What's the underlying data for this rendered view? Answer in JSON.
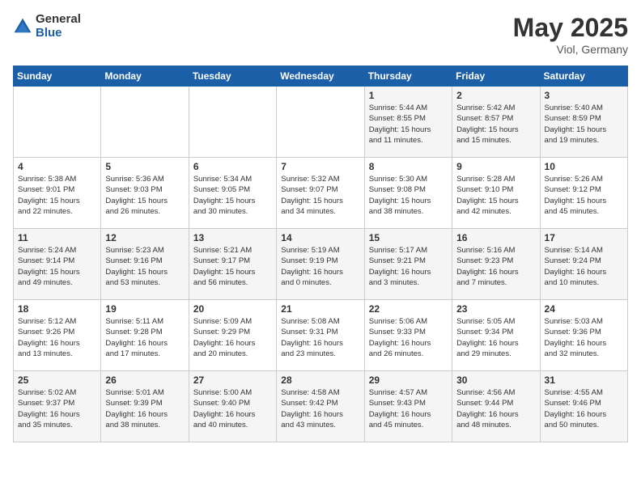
{
  "header": {
    "logo_general": "General",
    "logo_blue": "Blue",
    "month": "May 2025",
    "location": "Viol, Germany"
  },
  "weekdays": [
    "Sunday",
    "Monday",
    "Tuesday",
    "Wednesday",
    "Thursday",
    "Friday",
    "Saturday"
  ],
  "weeks": [
    [
      {
        "day": "",
        "content": ""
      },
      {
        "day": "",
        "content": ""
      },
      {
        "day": "",
        "content": ""
      },
      {
        "day": "",
        "content": ""
      },
      {
        "day": "1",
        "content": "Sunrise: 5:44 AM\nSunset: 8:55 PM\nDaylight: 15 hours\nand 11 minutes."
      },
      {
        "day": "2",
        "content": "Sunrise: 5:42 AM\nSunset: 8:57 PM\nDaylight: 15 hours\nand 15 minutes."
      },
      {
        "day": "3",
        "content": "Sunrise: 5:40 AM\nSunset: 8:59 PM\nDaylight: 15 hours\nand 19 minutes."
      }
    ],
    [
      {
        "day": "4",
        "content": "Sunrise: 5:38 AM\nSunset: 9:01 PM\nDaylight: 15 hours\nand 22 minutes."
      },
      {
        "day": "5",
        "content": "Sunrise: 5:36 AM\nSunset: 9:03 PM\nDaylight: 15 hours\nand 26 minutes."
      },
      {
        "day": "6",
        "content": "Sunrise: 5:34 AM\nSunset: 9:05 PM\nDaylight: 15 hours\nand 30 minutes."
      },
      {
        "day": "7",
        "content": "Sunrise: 5:32 AM\nSunset: 9:07 PM\nDaylight: 15 hours\nand 34 minutes."
      },
      {
        "day": "8",
        "content": "Sunrise: 5:30 AM\nSunset: 9:08 PM\nDaylight: 15 hours\nand 38 minutes."
      },
      {
        "day": "9",
        "content": "Sunrise: 5:28 AM\nSunset: 9:10 PM\nDaylight: 15 hours\nand 42 minutes."
      },
      {
        "day": "10",
        "content": "Sunrise: 5:26 AM\nSunset: 9:12 PM\nDaylight: 15 hours\nand 45 minutes."
      }
    ],
    [
      {
        "day": "11",
        "content": "Sunrise: 5:24 AM\nSunset: 9:14 PM\nDaylight: 15 hours\nand 49 minutes."
      },
      {
        "day": "12",
        "content": "Sunrise: 5:23 AM\nSunset: 9:16 PM\nDaylight: 15 hours\nand 53 minutes."
      },
      {
        "day": "13",
        "content": "Sunrise: 5:21 AM\nSunset: 9:17 PM\nDaylight: 15 hours\nand 56 minutes."
      },
      {
        "day": "14",
        "content": "Sunrise: 5:19 AM\nSunset: 9:19 PM\nDaylight: 16 hours\nand 0 minutes."
      },
      {
        "day": "15",
        "content": "Sunrise: 5:17 AM\nSunset: 9:21 PM\nDaylight: 16 hours\nand 3 minutes."
      },
      {
        "day": "16",
        "content": "Sunrise: 5:16 AM\nSunset: 9:23 PM\nDaylight: 16 hours\nand 7 minutes."
      },
      {
        "day": "17",
        "content": "Sunrise: 5:14 AM\nSunset: 9:24 PM\nDaylight: 16 hours\nand 10 minutes."
      }
    ],
    [
      {
        "day": "18",
        "content": "Sunrise: 5:12 AM\nSunset: 9:26 PM\nDaylight: 16 hours\nand 13 minutes."
      },
      {
        "day": "19",
        "content": "Sunrise: 5:11 AM\nSunset: 9:28 PM\nDaylight: 16 hours\nand 17 minutes."
      },
      {
        "day": "20",
        "content": "Sunrise: 5:09 AM\nSunset: 9:29 PM\nDaylight: 16 hours\nand 20 minutes."
      },
      {
        "day": "21",
        "content": "Sunrise: 5:08 AM\nSunset: 9:31 PM\nDaylight: 16 hours\nand 23 minutes."
      },
      {
        "day": "22",
        "content": "Sunrise: 5:06 AM\nSunset: 9:33 PM\nDaylight: 16 hours\nand 26 minutes."
      },
      {
        "day": "23",
        "content": "Sunrise: 5:05 AM\nSunset: 9:34 PM\nDaylight: 16 hours\nand 29 minutes."
      },
      {
        "day": "24",
        "content": "Sunrise: 5:03 AM\nSunset: 9:36 PM\nDaylight: 16 hours\nand 32 minutes."
      }
    ],
    [
      {
        "day": "25",
        "content": "Sunrise: 5:02 AM\nSunset: 9:37 PM\nDaylight: 16 hours\nand 35 minutes."
      },
      {
        "day": "26",
        "content": "Sunrise: 5:01 AM\nSunset: 9:39 PM\nDaylight: 16 hours\nand 38 minutes."
      },
      {
        "day": "27",
        "content": "Sunrise: 5:00 AM\nSunset: 9:40 PM\nDaylight: 16 hours\nand 40 minutes."
      },
      {
        "day": "28",
        "content": "Sunrise: 4:58 AM\nSunset: 9:42 PM\nDaylight: 16 hours\nand 43 minutes."
      },
      {
        "day": "29",
        "content": "Sunrise: 4:57 AM\nSunset: 9:43 PM\nDaylight: 16 hours\nand 45 minutes."
      },
      {
        "day": "30",
        "content": "Sunrise: 4:56 AM\nSunset: 9:44 PM\nDaylight: 16 hours\nand 48 minutes."
      },
      {
        "day": "31",
        "content": "Sunrise: 4:55 AM\nSunset: 9:46 PM\nDaylight: 16 hours\nand 50 minutes."
      }
    ]
  ]
}
